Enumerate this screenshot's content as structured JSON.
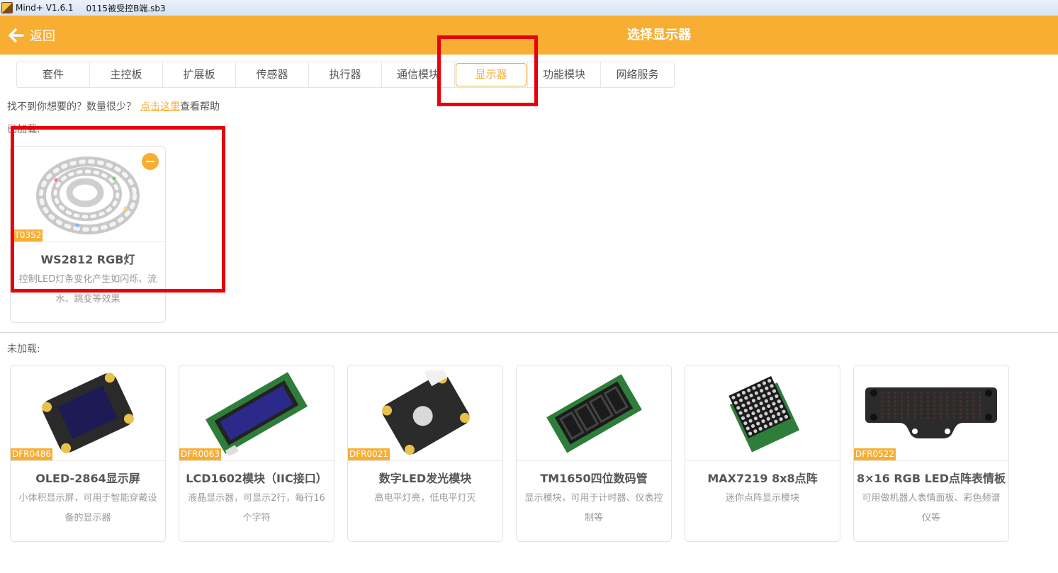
{
  "window": {
    "app_version": "Mind+ V1.6.1",
    "file_name": "0115被受控B端.sb3"
  },
  "header": {
    "back_label": "返回",
    "title": "选择显示器"
  },
  "tabs": [
    {
      "label": "套件"
    },
    {
      "label": "主控板"
    },
    {
      "label": "扩展板"
    },
    {
      "label": "传感器"
    },
    {
      "label": "执行器"
    },
    {
      "label": "通信模块"
    },
    {
      "label": "显示器",
      "active": true
    },
    {
      "label": "功能模块"
    },
    {
      "label": "网络服务"
    }
  ],
  "help": {
    "prefix": "找不到你想要的？数量很少？",
    "link": "点击这里",
    "suffix": "查看帮助"
  },
  "loaded": {
    "label": "已加载:",
    "items": [
      {
        "sku": "IT0352",
        "name": "WS2812 RGB灯",
        "desc": "控制LED灯条变化产生如闪烁、流水、跳变等效果"
      }
    ]
  },
  "not_loaded": {
    "label": "未加载:",
    "items": [
      {
        "sku": "DFR0486",
        "name": "OLED-2864显示屏",
        "desc": "小体积显示屏，可用于智能穿戴设备的显示器"
      },
      {
        "sku": "DFR0063",
        "name": "LCD1602模块（IIC接口）",
        "desc": "液晶显示器，可显示2行，每行16个字符"
      },
      {
        "sku": "DFR0021",
        "name": "数字LED发光模块",
        "desc": "高电平灯亮，低电平灯灭"
      },
      {
        "sku": "",
        "name": "TM1650四位数码管",
        "desc": "显示模块，可用于计时器、仪表控制等"
      },
      {
        "sku": "",
        "name": "MAX7219 8x8点阵",
        "desc": "迷你点阵显示模块"
      },
      {
        "sku": "DFR0522",
        "name": "8×16 RGB LED点阵表情板",
        "desc": "可用做机器人表情面板、彩色频谱仪等"
      }
    ]
  },
  "colors": {
    "accent": "#f7ae33",
    "annotation": "#e8000b"
  }
}
